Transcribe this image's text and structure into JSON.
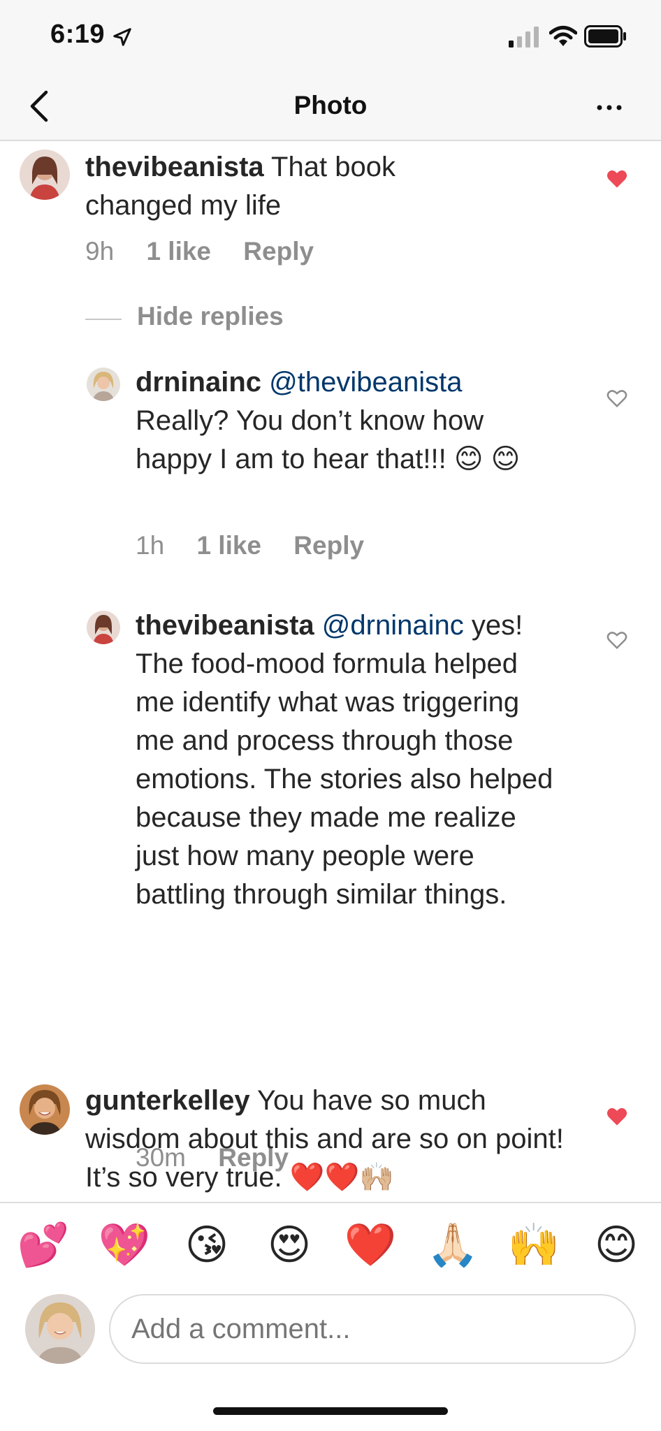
{
  "status_bar": {
    "time": "6:19"
  },
  "nav": {
    "title": "Photo"
  },
  "comments": [
    {
      "username": "thevibeanista",
      "text": "That book changed my life",
      "time": "9h",
      "likes": "1 like",
      "reply": "Reply",
      "liked": true
    },
    {
      "hide_replies": "Hide replies"
    },
    {
      "username": "drninainc",
      "mention": "@thevibeanista",
      "text": "Really? You don’t know how happy I am to hear that!!! 😊 😊",
      "time": "1h",
      "likes": "1 like",
      "reply": "Reply",
      "liked": false
    },
    {
      "username": "thevibeanista",
      "mention": "@drninainc",
      "text": "yes! The food-mood formula helped me identify what was triggering me and process through those emotions. The stories also helped because they made me realize just how many people were battling through similar things.",
      "time": "30m",
      "reply": "Reply",
      "liked": false
    },
    {
      "username": "gunterkelley",
      "text": "You have so much wisdom about this and are so on point! It’s so very true. ❤️❤️🙌🏼",
      "liked": true
    }
  ],
  "emoji_bar": [
    "💕",
    "💖",
    "😘",
    "😍",
    "❤️",
    "🙏🏻",
    "🙌",
    "😊"
  ],
  "comment_input": {
    "placeholder": "Add a comment..."
  },
  "colors": {
    "like_red": "#ed4956",
    "mention_blue": "#00376b",
    "meta_gray": "#8e8e8e"
  }
}
